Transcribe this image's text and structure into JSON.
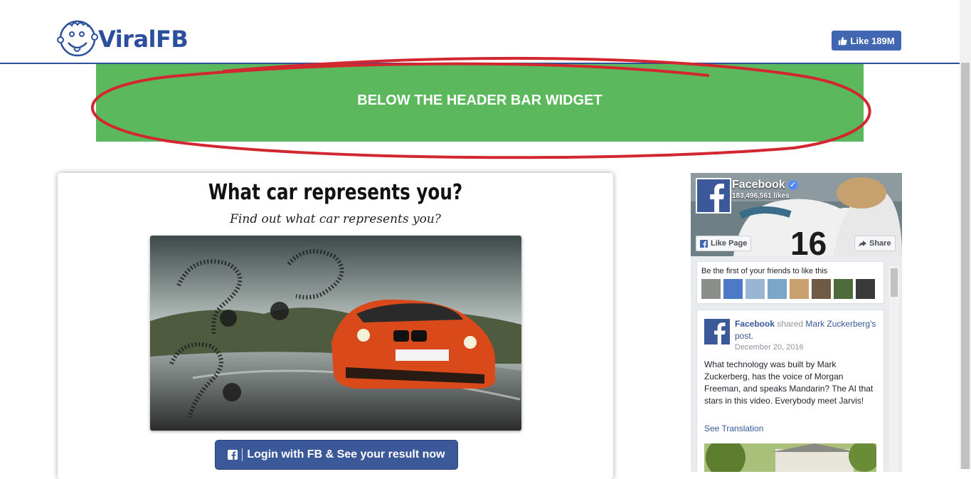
{
  "header": {
    "logo_text": "ViralFB",
    "like_button_label": "Like 189M"
  },
  "banner": {
    "text": "BELOW THE HEADER BAR WIDGET",
    "bg_color": "#5cb85c",
    "ring_color": "#d22630"
  },
  "quiz": {
    "title": "What car represents you?",
    "subtitle": "Find out what car represents you?",
    "login_label": "Login with FB & See your result now"
  },
  "fb_widget": {
    "page_name": "Facebook",
    "likes": "183,496,561 likes",
    "like_page_label": "Like Page",
    "share_label": "Share",
    "friends_text": "Be the first of your friends to like this",
    "post": {
      "author": "Facebook",
      "action": "shared",
      "target": "Mark Zuckerberg's post.",
      "date": "December 20, 2016",
      "body": "What technology was built by Mark Zuckerberg, has the voice of Morgan Freeman, and speaks Mandarin? The AI that stars in this video. Everybody meet Jarvis!",
      "translate_label": "See Translation"
    }
  },
  "colors": {
    "fb_blue": "#3b5998",
    "header_rule": "#2e4f9c"
  }
}
